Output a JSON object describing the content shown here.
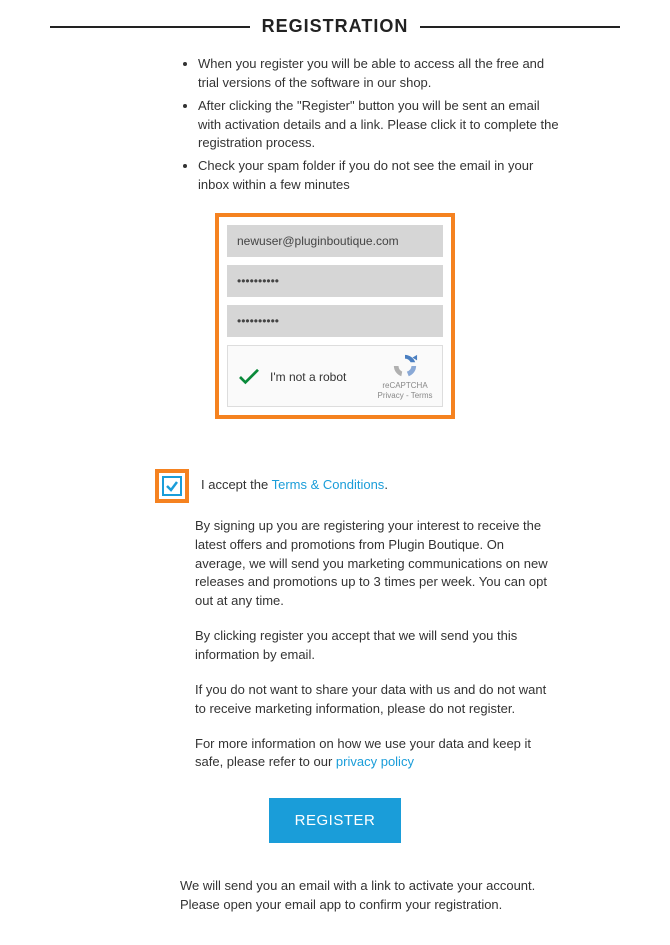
{
  "title": "REGISTRATION",
  "bullets": [
    "When you register you will be able to access all the free and trial versions of the software in our shop.",
    "After clicking the \"Register\" button you will be sent an email with activation details and a link. Please click it to complete the registration process.",
    "Check your spam folder if you do not see the email in your inbox within a few minutes"
  ],
  "form": {
    "email_value": "newuser@pluginboutique.com",
    "password1_value": "••••••••••",
    "password2_value": "••••••••••",
    "captcha_label": "I'm not a robot",
    "captcha_brand": "reCAPTCHA",
    "captcha_legal": "Privacy - Terms"
  },
  "consent": {
    "prefix": "I accept the ",
    "link_text": "Terms & Conditions",
    "suffix": "."
  },
  "paragraphs": {
    "p1": "By signing up you are registering your interest to receive the latest offers and promotions from Plugin Boutique. On average, we will send you marketing communications on new releases and promotions up to 3 times per week. You can opt out at any time.",
    "p2": "By clicking register you accept that we will send you this information by email.",
    "p3": "If you do not want to share your data with us and do not want to receive marketing information, please do not register.",
    "p4_prefix": "For more information on how we use your data and keep it safe, please refer to our ",
    "p4_link": "privacy policy"
  },
  "register_label": "REGISTER",
  "activation_note": "We will send you an email with a link to activate your account. Please open your email app to confirm your registration."
}
